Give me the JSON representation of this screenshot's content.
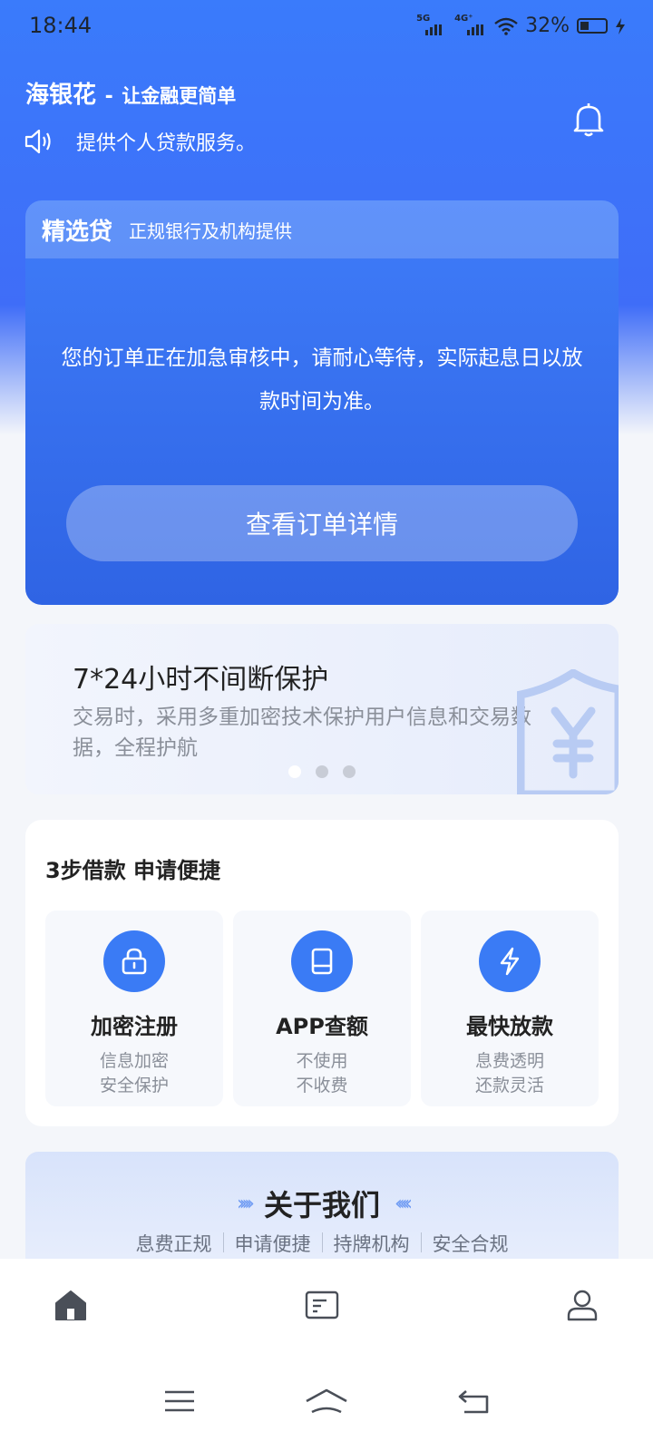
{
  "status_bar": {
    "time": "18:44",
    "net1": "5G",
    "net2": "4G⁺",
    "battery": "32%"
  },
  "header": {
    "app_name": "海银花",
    "separator": "-",
    "slogan": "让金融更简单",
    "notice": "提供个人贷款服务。"
  },
  "loan_card": {
    "title": "精选贷",
    "subtitle": "正规银行及机构提供",
    "message_line1": "您的订单正在加急审核中，请耐心等待，实际起息日以放",
    "message_line2": "款时间为准。",
    "button_label": "查看订单详情"
  },
  "banner": {
    "title": "7*24小时不间断保护",
    "desc_line1": "交易时，采用多重加密技术保护用户信息和交易数",
    "desc_line2": "据，全程护航",
    "slide_count": 3,
    "active_slide": 1
  },
  "steps": {
    "title": "3步借款 申请便捷",
    "items": [
      {
        "name": "加密注册",
        "line1": "信息加密",
        "line2": "安全保护",
        "icon": "lock-icon"
      },
      {
        "name": "APP查额",
        "line1": "不使用",
        "line2": "不收费",
        "icon": "tablet-icon"
      },
      {
        "name": "最快放款",
        "line1": "息费透明",
        "line2": "还款灵活",
        "icon": "lightning-icon"
      }
    ]
  },
  "about": {
    "title": "关于我们",
    "tags": [
      "息费正规",
      "申请便捷",
      "持牌机构",
      "安全合规"
    ]
  },
  "tabbar": {
    "items": [
      "home-icon",
      "document-icon",
      "profile-icon"
    ],
    "active": 0
  },
  "colors": {
    "accent": "#3a7bf5",
    "hero": "#3f6df8"
  }
}
